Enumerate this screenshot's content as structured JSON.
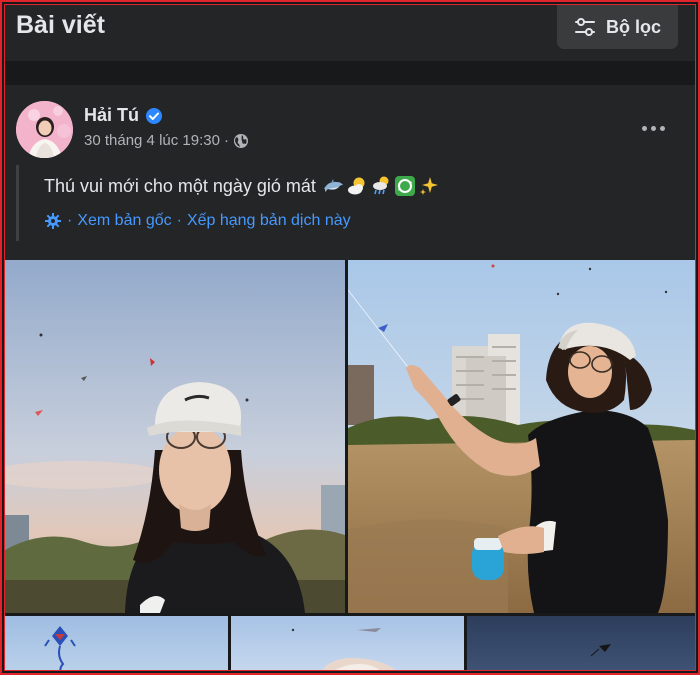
{
  "header": {
    "title": "Bài viết",
    "filter_label": "Bộ lọc",
    "filter_icon": "sliders-icon"
  },
  "post": {
    "author": "Hải Tú",
    "verified": true,
    "timestamp": "30 tháng 4 lúc 19:30",
    "meta_separator": "·",
    "privacy_icon": "globe-icon",
    "text": "Thú vui mới cho một ngày gió mát",
    "emojis": [
      "dolphin-icon",
      "sun-behind-cloud-icon",
      "sun-behind-rain-cloud-icon",
      "recycle-icon",
      "sparkles-icon"
    ],
    "translate": {
      "icon": "gear-icon",
      "separator": "·",
      "see_original": "Xem bản gốc",
      "rate_translation": "Xếp hạng bản dịch này"
    },
    "photos": [
      "photo-1",
      "photo-2",
      "photo-3",
      "photo-4",
      "photo-5"
    ]
  },
  "colors": {
    "background": "#18191a",
    "card": "#242526",
    "button": "#3a3b3c",
    "primary_text": "#e4e6eb",
    "secondary_text": "#b0b3b8",
    "link": "#4599ff",
    "verified_badge": "#2d88ff",
    "frame": "#e0242b"
  }
}
